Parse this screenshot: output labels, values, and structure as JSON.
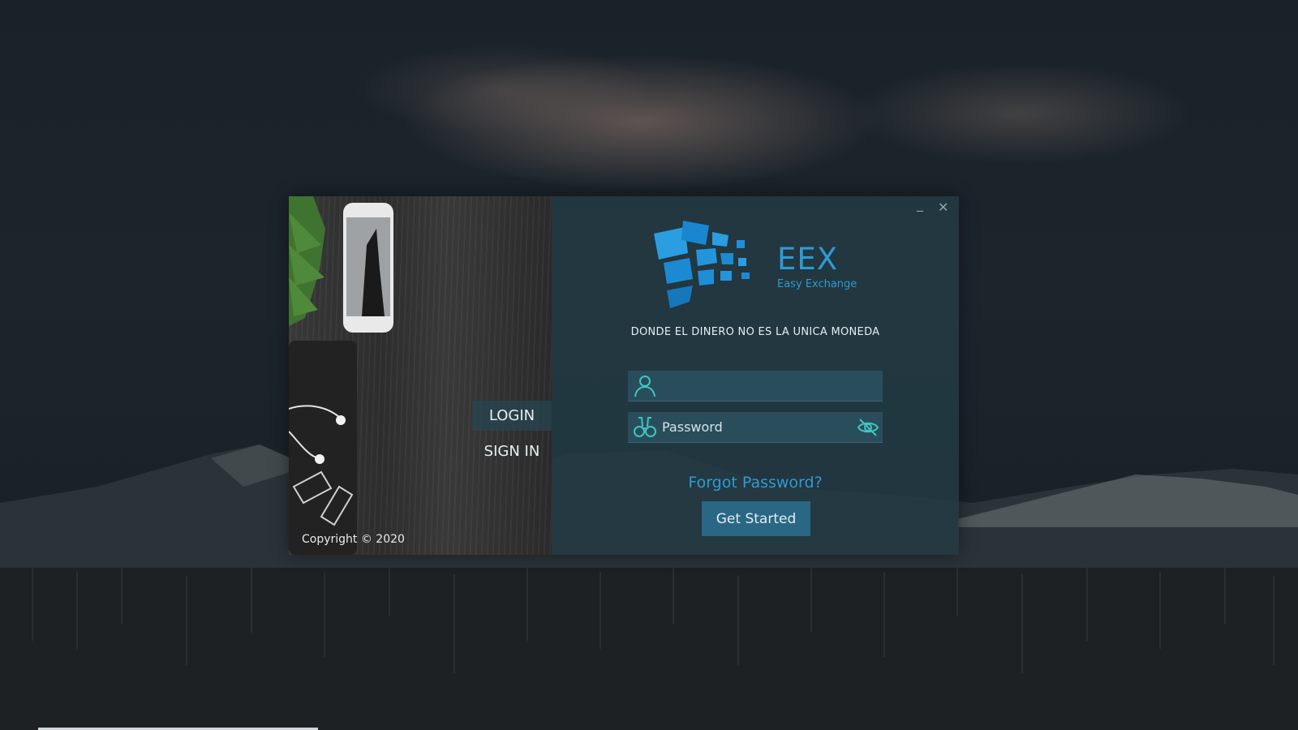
{
  "window": {
    "minimize_label": "_",
    "close_label": "✕"
  },
  "brand": {
    "name": "EEX",
    "subtitle": "Easy Exchange",
    "tagline": "DONDE EL DINERO NO ES LA UNICA MONEDA",
    "logo_color": "#1f8ed6"
  },
  "form": {
    "username": {
      "value": "",
      "placeholder": ""
    },
    "password": {
      "value": "",
      "placeholder": "Password"
    },
    "forgot_label": "Forgot Password?",
    "submit_label": "Get Started"
  },
  "side_nav": {
    "login_label": "LOGIN",
    "signin_label": "SIGN IN"
  },
  "footer": {
    "copyright": "Copyright © 2020"
  },
  "icons": {
    "user": "user-icon",
    "password": "binoculars-icon",
    "visibility": "eye-slash-icon",
    "minimize": "minimize-icon",
    "close": "close-icon"
  },
  "colors": {
    "accent": "#2f9ad3",
    "panel": "#233a44",
    "field": "#2a4d5c",
    "button": "#2a6784",
    "icon_teal": "#3fc5c1"
  }
}
